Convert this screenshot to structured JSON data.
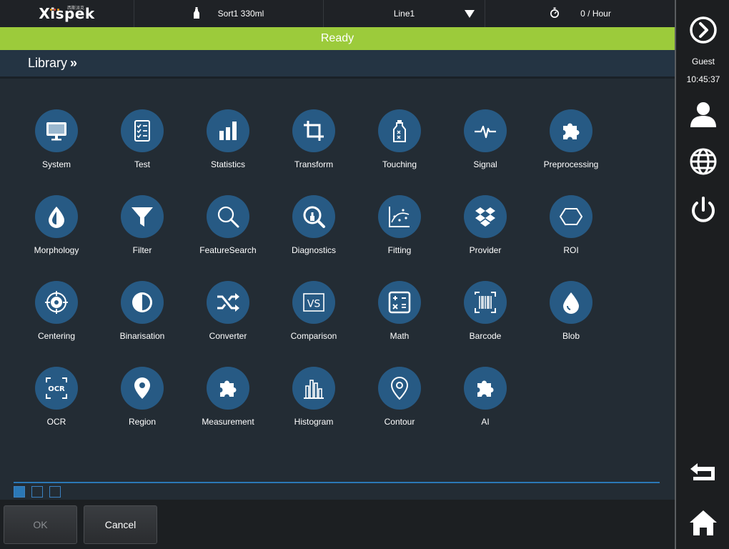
{
  "header": {
    "brand": "Xispek",
    "brand_sub": "西斯派克",
    "product": "Sort1 330ml",
    "line": "Line1",
    "rate": "0 / Hour"
  },
  "status": {
    "text": "Ready",
    "color": "#9ccb3b"
  },
  "library": {
    "title": "Library"
  },
  "tiles": [
    {
      "label": "System",
      "icon": "monitor-icon"
    },
    {
      "label": "Test",
      "icon": "checklist-icon"
    },
    {
      "label": "Statistics",
      "icon": "bar-chart-icon"
    },
    {
      "label": "Transform",
      "icon": "crop-icon"
    },
    {
      "label": "Touching",
      "icon": "bottle-icon"
    },
    {
      "label": "Signal",
      "icon": "pulse-icon"
    },
    {
      "label": "Preprocessing",
      "icon": "puzzle-icon"
    },
    {
      "label": "Morphology",
      "icon": "drop-half-icon"
    },
    {
      "label": "Filter",
      "icon": "funnel-icon"
    },
    {
      "label": "FeatureSearch",
      "icon": "magnifier-icon"
    },
    {
      "label": "Diagnostics",
      "icon": "diagnostic-magnifier-icon"
    },
    {
      "label": "Fitting",
      "icon": "scatter-fit-icon"
    },
    {
      "label": "Provider",
      "icon": "dropbox-icon"
    },
    {
      "label": "ROI",
      "icon": "hexagon-icon"
    },
    {
      "label": "Centering",
      "icon": "crosshair-icon"
    },
    {
      "label": "Binarisation",
      "icon": "half-circle-icon"
    },
    {
      "label": "Converter",
      "icon": "shuffle-icon"
    },
    {
      "label": "Comparison",
      "icon": "vs-icon"
    },
    {
      "label": "Math",
      "icon": "calculator-icon"
    },
    {
      "label": "Barcode",
      "icon": "barcode-icon"
    },
    {
      "label": "Blob",
      "icon": "drop-icon"
    },
    {
      "label": "OCR",
      "icon": "ocr-icon"
    },
    {
      "label": "Region",
      "icon": "map-pin-icon"
    },
    {
      "label": "Measurement",
      "icon": "puzzle-icon"
    },
    {
      "label": "Histogram",
      "icon": "histogram-icon"
    },
    {
      "label": "Contour",
      "icon": "location-outline-icon"
    },
    {
      "label": "AI",
      "icon": "puzzle-icon"
    }
  ],
  "pager": {
    "pages": 3,
    "active": 0
  },
  "buttons": {
    "ok": "OK",
    "cancel": "Cancel"
  },
  "sidebar": {
    "user": "Guest",
    "time": "10:45:37"
  },
  "colors": {
    "tile_bg": "#275a84",
    "accent": "#2b78b6",
    "panel": "#232c34"
  }
}
